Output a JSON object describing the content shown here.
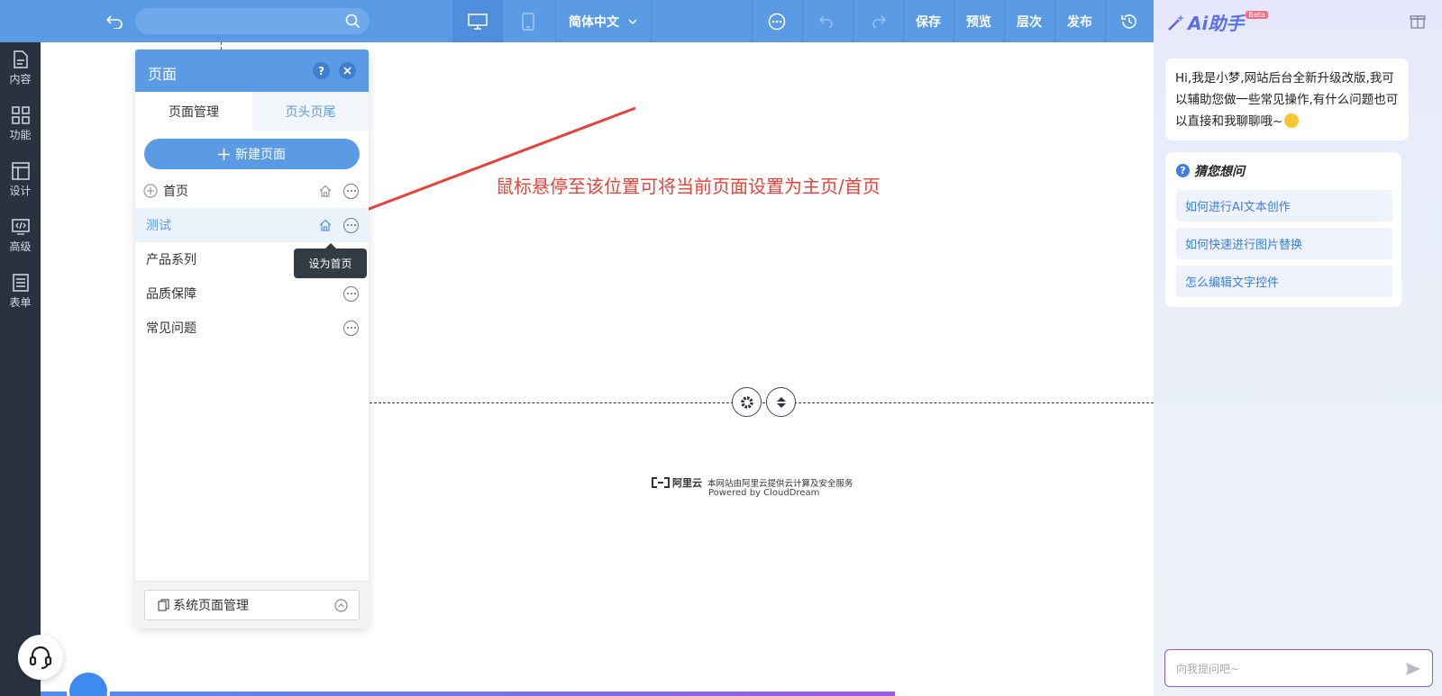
{
  "topbar": {
    "language": "简体中文",
    "save": "保存",
    "preview": "预览",
    "layers": "层次",
    "publish": "发布"
  },
  "sidebar": {
    "items": [
      {
        "label": "内容",
        "icon": "document-icon"
      },
      {
        "label": "功能",
        "icon": "grid-icon"
      },
      {
        "label": "设计",
        "icon": "layout-icon"
      },
      {
        "label": "高级",
        "icon": "code-icon"
      },
      {
        "label": "表单",
        "icon": "form-icon"
      }
    ]
  },
  "page_panel": {
    "title": "页面",
    "tabs": [
      "页面管理",
      "页头页尾"
    ],
    "new_page": "新建页面",
    "pages": [
      "首页",
      "测试",
      "产品系列",
      "品质保障",
      "常见问题"
    ],
    "tooltip": "设为首页",
    "system_pages": "系统页面管理"
  },
  "annotation": "鼠标悬停至该位置可将当前页面设置为主页/首页",
  "footer": {
    "brand": "阿里云",
    "line1": "本网站由阿里云提供云计算及安全服务",
    "line2": "Powered by CloudDream"
  },
  "ai": {
    "title": "Ai助手",
    "badge": "Beta",
    "greeting": "Hi,我是小梦,网站后台全新升级改版,我可以辅助您做一些常见操作,有什么问题也可以直接和我聊聊哦~",
    "guess_title": "猜您想问",
    "questions": [
      "如何进行AI文本创作",
      "如何快速进行图片替换",
      "怎么编辑文字控件"
    ],
    "input_placeholder": "向我提问吧~"
  },
  "colors": {
    "topbar": "#5b9be6",
    "sidebar": "#2a3240",
    "accent": "#3a7ee0",
    "annotation": "#e8433a"
  }
}
